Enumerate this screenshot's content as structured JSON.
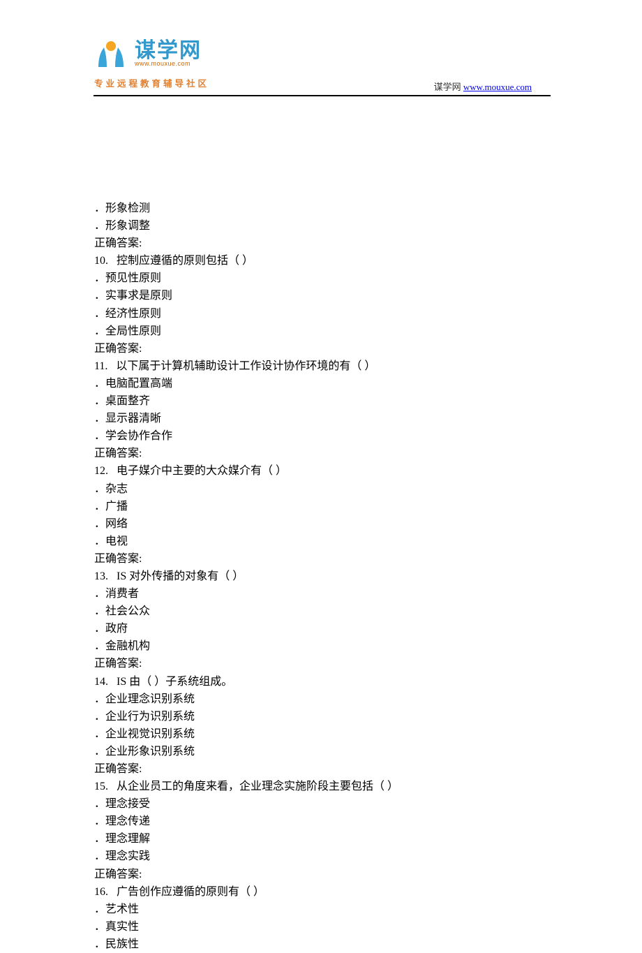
{
  "header": {
    "logo_cn": "谋学网",
    "logo_url_text": "www.mouxue.com",
    "logo_tagline": "专业远程教育辅导社区",
    "right_label": "谋学网",
    "right_url_text": "www.mouxue.com",
    "right_url_href": "http://www.mouxue.com"
  },
  "pre_options": [
    "．形象检测",
    "．形象调整"
  ],
  "pre_answer": "正确答案:",
  "questions": [
    {
      "num": "10.",
      "stem": "控制应遵循的原则包括（ ）",
      "options": [
        "．预见性原则",
        "．实事求是原则",
        "．经济性原则",
        "．全局性原则"
      ],
      "answer": "正确答案:"
    },
    {
      "num": "11.",
      "stem": "以下属于计算机辅助设计工作设计协作环境的有（ ）",
      "options": [
        "．电脑配置高端",
        "．桌面整齐",
        "．显示器清晰",
        "．学会协作合作"
      ],
      "answer": "正确答案:"
    },
    {
      "num": "12.",
      "stem": "电子媒介中主要的大众媒介有（ ）",
      "options": [
        "．杂志",
        "．广播",
        "．网络",
        "．电视"
      ],
      "answer": "正确答案:"
    },
    {
      "num": "13.",
      "stem": "IS 对外传播的对象有（ ）",
      "options": [
        "．消费者",
        "．社会公众",
        "．政府",
        "．金融机构"
      ],
      "answer": "正确答案:"
    },
    {
      "num": "14.",
      "stem": "IS 由（ ）子系统组成。",
      "options": [
        "．企业理念识别系统",
        "．企业行为识别系统",
        "．企业视觉识别系统",
        "．企业形象识别系统"
      ],
      "answer": "正确答案:"
    },
    {
      "num": "15.",
      "stem": "从企业员工的角度来看，企业理念实施阶段主要包括（ ）",
      "options": [
        "．理念接受",
        "．理念传递",
        "．理念理解",
        "．理念实践"
      ],
      "answer": "正确答案:"
    },
    {
      "num": "16.",
      "stem": "广告创作应遵循的原则有（ ）",
      "options": [
        "．艺术性",
        "．真实性",
        "．民族性"
      ],
      "answer": ""
    }
  ]
}
